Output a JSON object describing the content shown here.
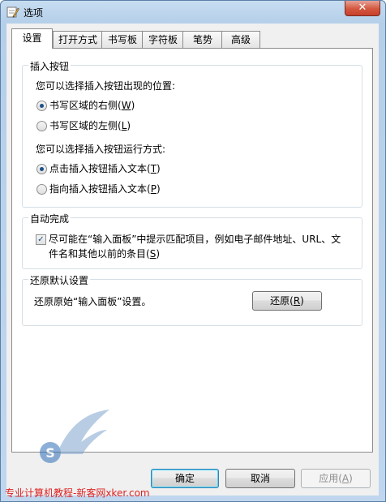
{
  "window": {
    "title": "选项",
    "close_label": "✕"
  },
  "tabs": [
    {
      "label": "设置",
      "active": true
    },
    {
      "label": "打开方式"
    },
    {
      "label": "书写板"
    },
    {
      "label": "字符板"
    },
    {
      "label": "笔势"
    },
    {
      "label": "高级"
    }
  ],
  "insert_button": {
    "group_title": "插入按钮",
    "position_prompt": "您可以选择插入按钮出现的位置:",
    "position_right": {
      "text": "书写区域的右侧(",
      "key": "W",
      "end": ")",
      "checked": true
    },
    "position_left": {
      "text": "书写区域的左侧(",
      "key": "L",
      "end": ")",
      "checked": false
    },
    "run_prompt": "您可以选择插入按钮运行方式:",
    "run_click": {
      "text": "点击插入按钮插入文本(",
      "key": "T",
      "end": ")",
      "checked": true
    },
    "run_point": {
      "text": "指向插入按钮插入文本(",
      "key": "P",
      "end": ")",
      "checked": false
    }
  },
  "autocomplete": {
    "group_title": "自动完成",
    "line1": "尽可能在“输入面板”中提示匹配项目，例如电子邮件地址、URL、文",
    "line2_pre": "件名和其他以前的条目(",
    "line2_key": "S",
    "line2_end": ")",
    "checked": true
  },
  "restore": {
    "group_title": "还原默认设置",
    "description": "还原原始“输入面板”设置。",
    "button_text": "还原(",
    "button_key": "R",
    "button_end": ")"
  },
  "footer": {
    "ok": "确定",
    "cancel": "取消",
    "apply_text": "应用(",
    "apply_key": "A",
    "apply_end": ")"
  },
  "watermark": "专业计算机教程-新客网xker.com",
  "colors": {
    "accent": "#1d4f8c",
    "watermark": "#dd2222",
    "titlebar": "#c7ddf1"
  }
}
